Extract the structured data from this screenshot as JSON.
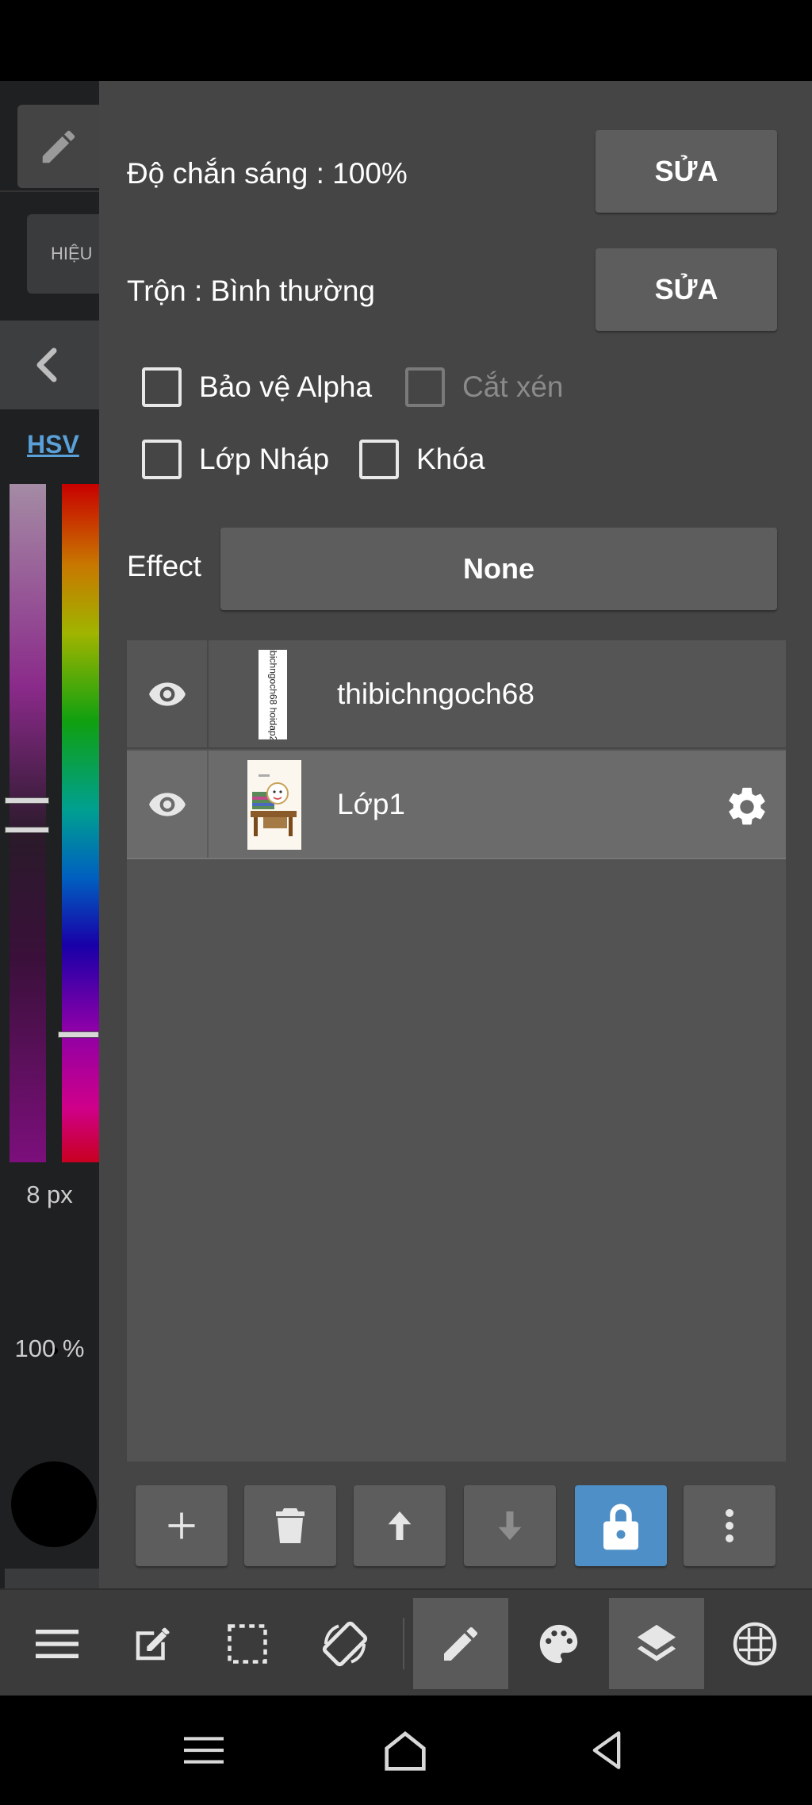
{
  "left_strip": {
    "effect_tab_label": "HIỆU",
    "color_mode_label": "HSV",
    "brush_size": "8 px",
    "brush_opacity": "100 %",
    "current_color": "#000000"
  },
  "panel": {
    "opacity_label": "Độ chắn sáng : 100%",
    "opacity_edit_label": "SỬA",
    "blend_label": "Trộn : Bình thường",
    "blend_edit_label": "SỬA",
    "checkboxes": {
      "protect_alpha": {
        "label": "Bảo vệ Alpha",
        "checked": false
      },
      "clipping": {
        "label": "Cắt xén",
        "checked": false,
        "disabled": true
      },
      "draft_layer": {
        "label": "Lớp Nháp",
        "checked": false
      },
      "lock": {
        "label": "Khóa",
        "checked": false
      }
    },
    "effect_label": "Effect",
    "effect_value": "None"
  },
  "layers": [
    {
      "name": "thibichngoch68",
      "visible": true,
      "selected": false,
      "thumb_text": "thibichngoch68 hoidap247"
    },
    {
      "name": "Lớp1",
      "visible": true,
      "selected": true
    }
  ],
  "layer_buttons": [
    {
      "icon": "plus-icon",
      "enabled": true
    },
    {
      "icon": "trash-icon",
      "enabled": true
    },
    {
      "icon": "arrow-up-icon",
      "enabled": true
    },
    {
      "icon": "arrow-down-icon",
      "enabled": false
    },
    {
      "icon": "lock-icon",
      "active": true
    },
    {
      "icon": "more-vertical-icon",
      "enabled": true
    }
  ],
  "colors": {
    "panel_bg": "#454545",
    "button_bg": "#5d5d5d",
    "accent": "#4d8fc6",
    "selected_row": "#6b6b6b",
    "hsv_label": "#5aa0d8"
  }
}
